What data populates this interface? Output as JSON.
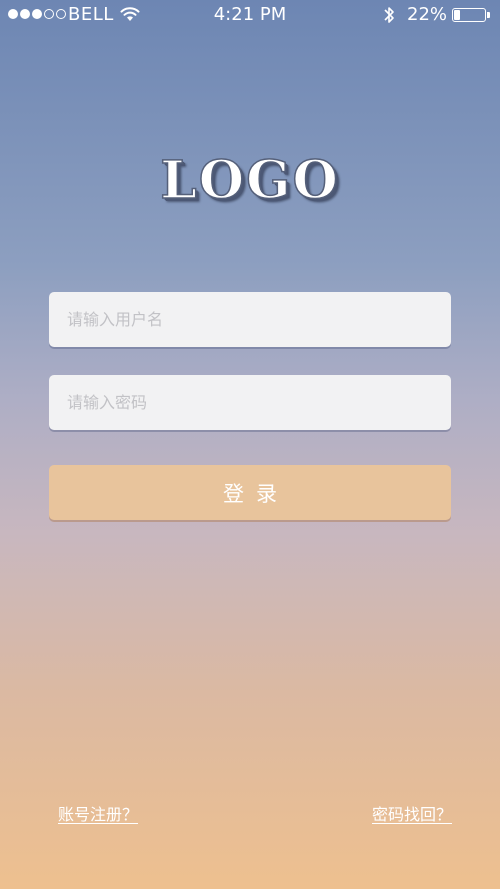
{
  "status_bar": {
    "carrier": "BELL",
    "time": "4:21 PM",
    "battery_percent_text": "22%",
    "battery_level": 0.22,
    "signal_bars_filled": 3,
    "signal_bars_total": 5,
    "icons": [
      "wifi-icon",
      "bluetooth-icon",
      "battery-icon"
    ]
  },
  "logo": {
    "text": "LOGO"
  },
  "login_form": {
    "username_placeholder": "请输入用户名",
    "password_placeholder": "请输入密码",
    "submit_label": "登录"
  },
  "footer": {
    "register_link": "账号注册？",
    "forgot_password_link": "密码找回？"
  },
  "colors": {
    "background_top": "#6d86b3",
    "background_bottom": "#eec08f",
    "button": "#e8c49c",
    "input_background": "#f2f2f3"
  }
}
